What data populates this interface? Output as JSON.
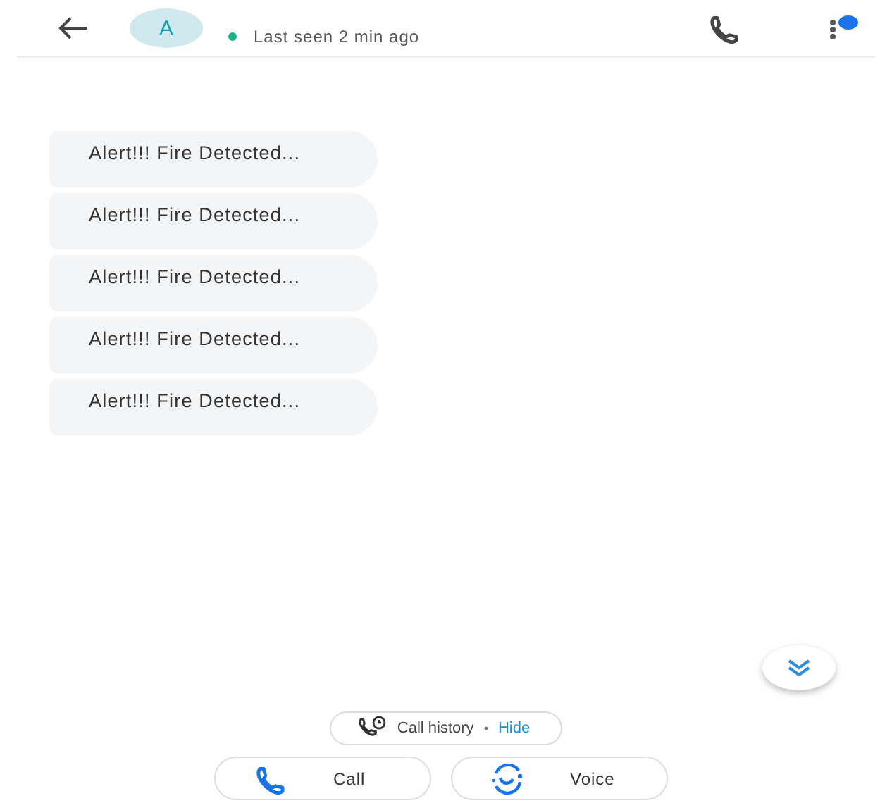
{
  "header": {
    "avatar_letter": "A",
    "status": "Last seen 2 min ago"
  },
  "messages": [
    {
      "text": "Alert!!! Fire Detected..."
    },
    {
      "text": "Alert!!! Fire Detected..."
    },
    {
      "text": "Alert!!! Fire Detected..."
    },
    {
      "text": "Alert!!! Fire Detected..."
    },
    {
      "text": "Alert!!! Fire Detected..."
    }
  ],
  "call_history": {
    "label": "Call history",
    "separator": "•",
    "action": "Hide"
  },
  "buttons": [
    {
      "kind": "call",
      "label": "Call"
    },
    {
      "kind": "voice",
      "label": "Voice"
    }
  ]
}
